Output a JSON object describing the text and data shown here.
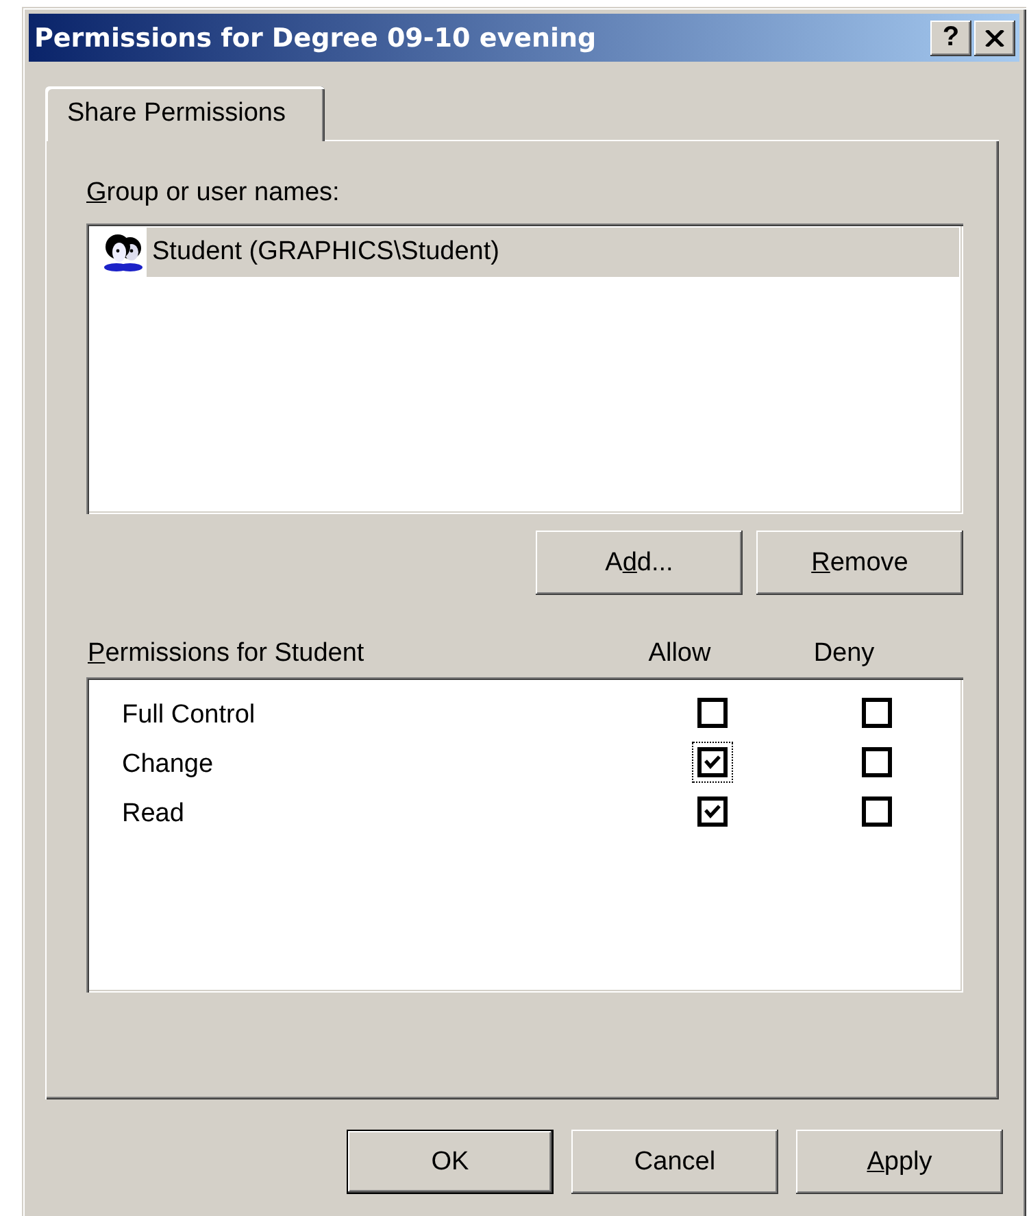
{
  "window": {
    "title": "Permissions for Degree 09-10 evening",
    "help": "?"
  },
  "tabs": [
    {
      "label": "Share Permissions",
      "selected": true
    }
  ],
  "groups": {
    "access_key": "G",
    "label_end": "roup or user names:",
    "items": [
      {
        "name": "Student (GRAPHICS\\Student)",
        "selected": true
      }
    ]
  },
  "group_buttons": [
    {
      "label_start": "A",
      "access_key": "d",
      "label_end": "d..."
    },
    {
      "access_key": "R",
      "label_end": "emove"
    }
  ],
  "permissions": {
    "access_key": "P",
    "label_end": "ermissions for Student",
    "columns": [
      "Allow",
      "Deny"
    ],
    "rows": [
      {
        "name": "Full Control",
        "allow": false,
        "deny": false,
        "focused": false
      },
      {
        "name": "Change",
        "allow": true,
        "deny": false,
        "focused": true
      },
      {
        "name": "Read",
        "allow": true,
        "deny": false,
        "focused": false
      }
    ]
  },
  "buttons": [
    {
      "label_end": "OK",
      "default": true
    },
    {
      "label_end": "Cancel",
      "default": false
    },
    {
      "access_key": "A",
      "label_end": "pply",
      "default": false
    }
  ]
}
